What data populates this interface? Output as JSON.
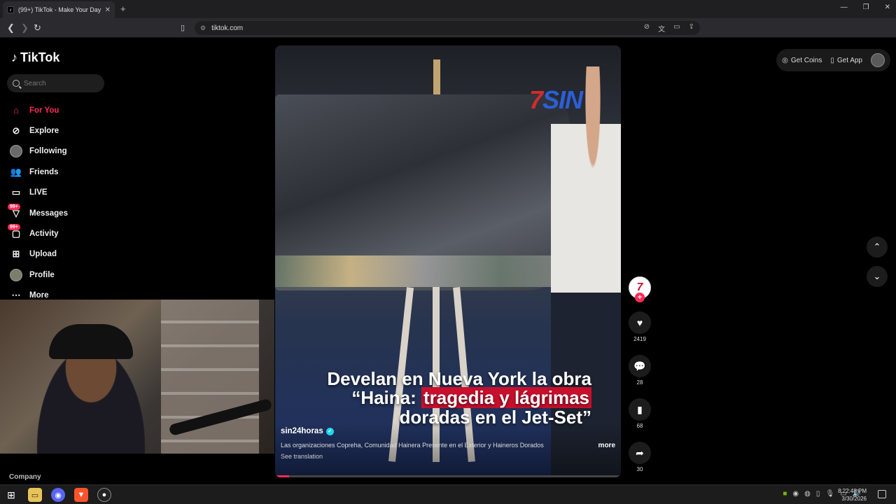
{
  "browser": {
    "tab_title": "(99+) TikTok - Make Your Day",
    "tab_close": "✕",
    "new_tab": "+",
    "url": "tiktok.com",
    "window_controls": [
      "—",
      "❐",
      "✕"
    ]
  },
  "sidebar": {
    "logo_text": "TikTok",
    "search_placeholder": "Search",
    "items": [
      {
        "label": "For You",
        "icon": "home-icon"
      },
      {
        "label": "Explore",
        "icon": "compass-icon"
      },
      {
        "label": "Following",
        "icon": "following-avatar-icon"
      },
      {
        "label": "Friends",
        "icon": "friends-icon"
      },
      {
        "label": "LIVE",
        "icon": "live-icon"
      },
      {
        "label": "Messages",
        "icon": "messages-icon",
        "badge": "99+"
      },
      {
        "label": "Activity",
        "icon": "activity-icon",
        "badge": "99+"
      },
      {
        "label": "Upload",
        "icon": "upload-icon"
      },
      {
        "label": "Profile",
        "icon": "profile-avatar-icon"
      },
      {
        "label": "More",
        "icon": "more-icon"
      }
    ],
    "company": "Company"
  },
  "video": {
    "watermark": "SIN",
    "caption_line1": "Develan en Nueva York la obra",
    "caption_line2_pre": "“Haina: ",
    "caption_line2_hl": "tragedia y lágrimas",
    "caption_line3": "doradas en el Jet-Set”",
    "author": "sin24horas",
    "description": "Las organizaciones Copreha, Comunidad Hainera Presente en el Exterior y Haineros Dorados",
    "more": "more",
    "see_translation": "See translation",
    "progress": 0.04
  },
  "actions": {
    "likes": "2419",
    "comments": "28",
    "bookmarks": "68",
    "shares": "30"
  },
  "topright": {
    "get_coins": "Get Coins",
    "get_app": "Get App"
  },
  "taskbar": {
    "time": "8:22:48 PM",
    "date": "3/30/2026"
  }
}
